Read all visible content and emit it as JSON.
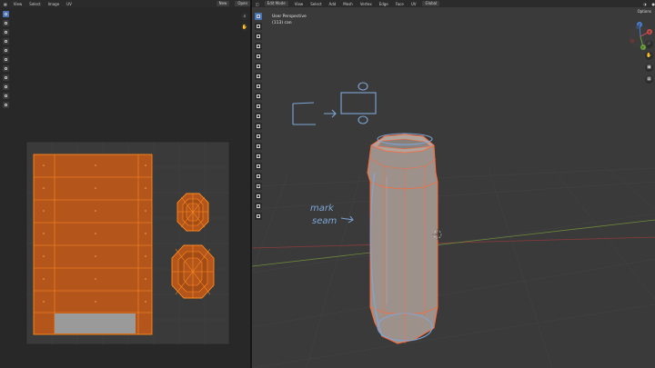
{
  "uv_editor": {
    "header": {
      "menus": [
        "View",
        "Select",
        "Image",
        "UV"
      ],
      "new_label": "New",
      "open_label": "Open"
    }
  },
  "viewport": {
    "header": {
      "mode": "Edit Mode",
      "menus": [
        "View",
        "Select",
        "Add",
        "Mesh",
        "Vertex",
        "Edge",
        "Face",
        "UV"
      ],
      "transform": "Global"
    },
    "overlay": {
      "view_name": "User Perspective",
      "object": "(113) can"
    },
    "options_label": "Options",
    "annotation": {
      "line1": "mark",
      "line2": "seam"
    },
    "gizmo": {
      "x": "X",
      "y": "Y",
      "z": "Z"
    }
  },
  "colors": {
    "uv_face": "#b4561c",
    "selection": "#ff8a1a",
    "annotation": "#7ea6d6",
    "seam": "#ff4a2a",
    "active_tool": "#4772b3"
  }
}
